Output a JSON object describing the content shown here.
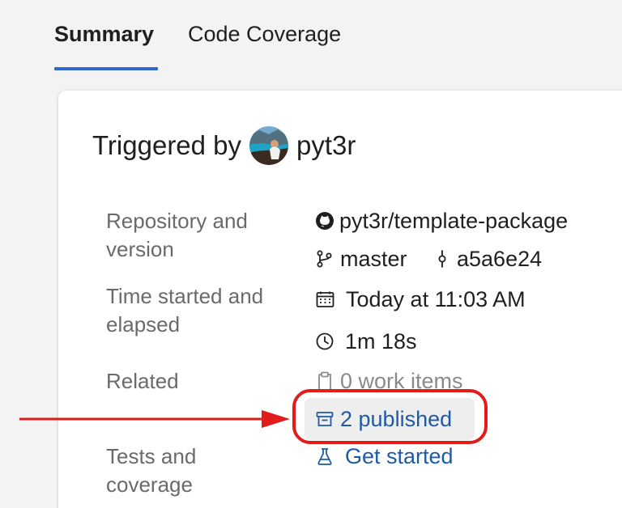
{
  "tabs": [
    {
      "label": "Summary",
      "selected": true
    },
    {
      "label": "Code Coverage",
      "selected": false
    }
  ],
  "summary": {
    "triggered_by_label": "Triggered by",
    "user": "pyt3r",
    "repository_label": "Repository and",
    "version_label": "version",
    "repository": "pyt3r/template-package",
    "branch": "master",
    "commit": "a5a6e24",
    "time_label_1": "Time started and",
    "time_label_2": "elapsed",
    "time_started": "Today at 11:03 AM",
    "elapsed": "1m 18s",
    "related_label": "Related",
    "work_items": "0 work items",
    "published": "2 published",
    "tests_label_1": "Tests and",
    "tests_label_2": "coverage",
    "tests_link": "Get started"
  },
  "icons": {
    "repository": "github-icon",
    "branch": "branch-icon",
    "commit": "commit-icon",
    "calendar": "calendar-icon",
    "clock": "clock-icon",
    "work_items": "clipboard-icon",
    "published": "artifact-icon",
    "tests": "beaker-icon"
  },
  "colors": {
    "selected_tab": "#2f66d0",
    "link": "#1f5aa6",
    "highlight": "#e21b1b"
  }
}
